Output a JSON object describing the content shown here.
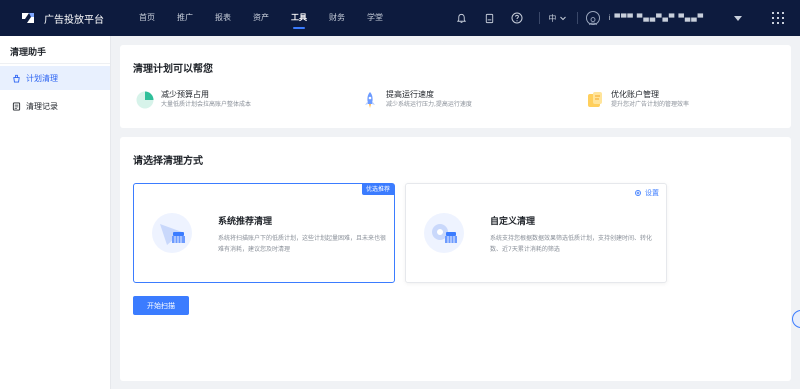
{
  "header": {
    "brand": "广告投放平台",
    "nav": [
      "首页",
      "推广",
      "报表",
      "资产",
      "工具",
      "财务",
      "学堂"
    ],
    "active_nav": "工具",
    "lang": "中",
    "user_name": "ⅰ ▀▀▀ ▀▄▄▀▄▀ ▀▄▄▀",
    "icons": [
      "bell-icon",
      "document-icon",
      "help-icon",
      "chevron-down-icon",
      "avatar",
      "caret-down-icon",
      "apps-grid-icon"
    ]
  },
  "sidebar": {
    "title": "清理助手",
    "items": [
      {
        "label": "计划清理",
        "icon": "cleanup-icon",
        "active": true
      },
      {
        "label": "清理记录",
        "icon": "record-icon",
        "active": false
      }
    ]
  },
  "intro": {
    "title": "清理计划可以帮您",
    "benefits": [
      {
        "title": "减少预算占用",
        "desc": "大量低质计划会拉高账户整体成本",
        "icon": "pie-chart-icon"
      },
      {
        "title": "提高运行速度",
        "desc": "减少系统运行压力,提高运行速度",
        "icon": "rocket-icon"
      },
      {
        "title": "优化账户管理",
        "desc": "提升您对广告计划的管理效率",
        "icon": "folder-icon"
      }
    ]
  },
  "method": {
    "title": "请选择清理方式",
    "cards": [
      {
        "title": "系统推荐清理",
        "desc": "系统将扫描账户下的低质计划，这些计划起量困难，且未来也很难有消耗，建议您及时清理",
        "badge": "优选推荐",
        "selected": true
      },
      {
        "title": "自定义清理",
        "desc": "系统支持您根据数据效果筛选低质计划，支持创建时间、转化数、近7天累计消耗的筛选",
        "setting_label": "设置",
        "selected": false
      }
    ],
    "start_button": "开始扫描"
  },
  "colors": {
    "nav_bg": "#0d1b3e",
    "accent": "#3b7cff",
    "sidebar_active_bg": "#e8f0fe",
    "page_bg": "#f0f2f5"
  }
}
